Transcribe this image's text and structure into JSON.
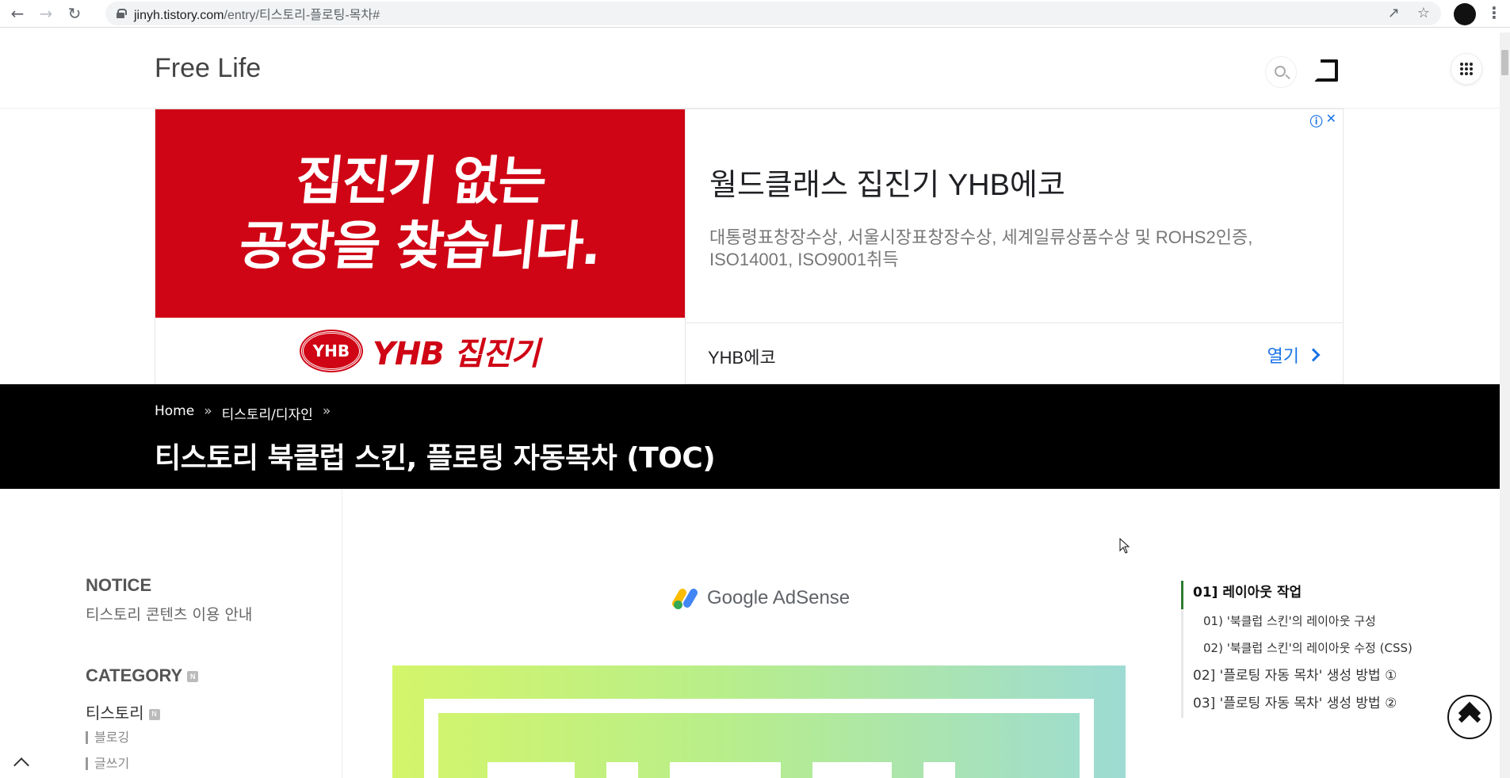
{
  "browser": {
    "url_host": "jinyh.tistory.com",
    "url_path": "/entry/티스토리-플로팅-목차#"
  },
  "blog": {
    "title": "Free Life"
  },
  "ad": {
    "image_line1": "집진기 없는",
    "image_line2": "공장을 찾습니다.",
    "logo_mark": "YHB",
    "logo_text": "YHB 집진기",
    "headline": "월드클래스 집진기 YHB에코",
    "description": "대통령표창장수상, 서울시장표창장수상, 세계일류상품수상 및 ROHS2인증, ISO14001, ISO9001취득",
    "advertiser": "YHB에코",
    "open_label": "열기"
  },
  "post": {
    "breadcrumb": [
      "Home",
      "티스토리/디자인"
    ],
    "breadcrumb_sep": "»",
    "title": "티스토리 북클럽 스킨, 플로팅 자동목차 (TOC)"
  },
  "sidebar": {
    "notice_heading": "NOTICE",
    "notice_link": "티스토리 콘텐츠 이용 안내",
    "category_heading": "CATEGORY",
    "category_main": "티스토리",
    "sub_items": [
      "블로깅",
      "글쓰기"
    ],
    "new_badge": "N"
  },
  "adsense": {
    "label": "Google AdSense"
  },
  "toc": {
    "items": [
      {
        "label": "01] 레이아웃 작업",
        "level": 1,
        "active": true
      },
      {
        "label": "01) '북클럽 스킨'의 레이아웃 구성",
        "level": 2,
        "active": false
      },
      {
        "label": "02) '북클럽 스킨'의 레이아웃 수정 (CSS)",
        "level": 2,
        "active": false
      },
      {
        "label": "02] '플로팅 자동 목차' 생성 방법 ①",
        "level": 1,
        "active": false
      },
      {
        "label": "03] '플로팅 자동 목차' 생성 방법 ②",
        "level": 1,
        "active": false
      }
    ]
  },
  "colors": {
    "ad_red": "#cf0515",
    "link_blue": "#1a73e8",
    "toc_active": "#2e7d32"
  }
}
